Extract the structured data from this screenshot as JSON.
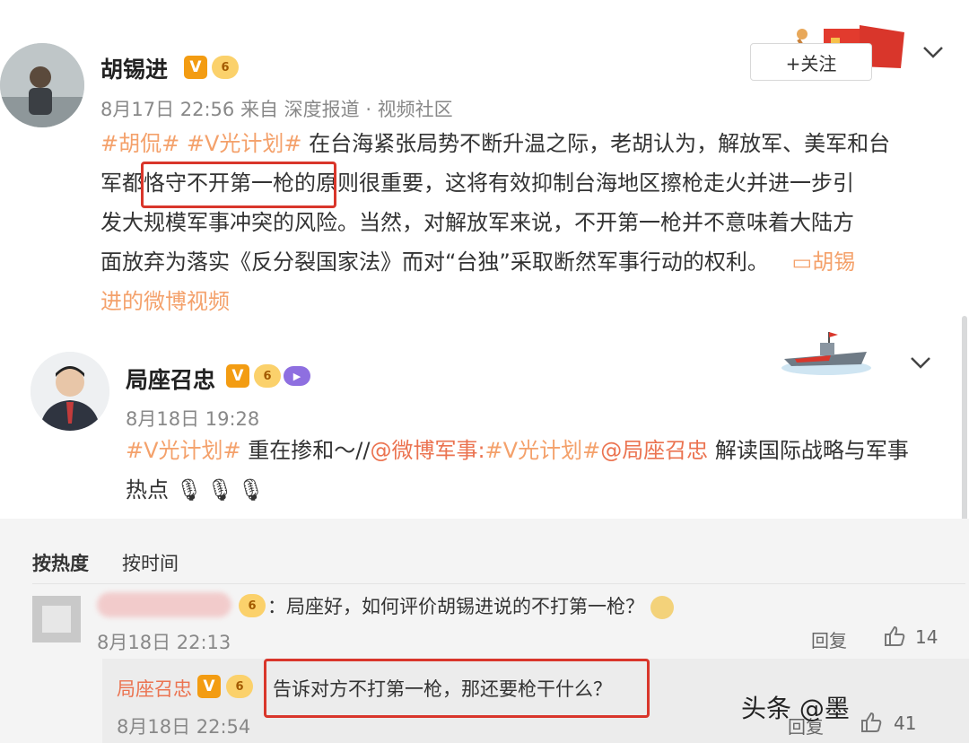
{
  "post1": {
    "author": "胡锡进",
    "date": "8月17日 22:56",
    "source": "来自 深度报道 · 视频社区",
    "follow_label": "+关注",
    "tag1": "#胡侃#",
    "tag2": "#V光计划#",
    "line1_text": " 在台海紧张局势不断升温之际，老胡认为，解放军、美军和台",
    "line2_pre": "军都",
    "line2_highlight": "恪守不开第一枪的",
    "line2_post": "原则很重要，这将有效抑制台海地区擦枪走火并进一步引",
    "line3": "发大规模军事冲突的风险。当然，对解放军来说，不开第一枪并不意味着大陆方",
    "line4": "面放弃为落实《反分裂国家法》而对“台独”采取断然军事行动的权利。",
    "video_link_a": "胡锡",
    "video_link_b": "进的微博视频"
  },
  "post2": {
    "author": "局座召忠",
    "date": "8月18日 19:28",
    "tag": "#V光计划#",
    "text_a": " 重在掺和～//",
    "mention1": "@微博军事",
    "text_b": ":",
    "tag2": "#V光计划#",
    "mention2": "@局座召忠",
    "text_c": " 解读国际战略与军事",
    "line2": "热点",
    "emoji": "🎙🎙🎙"
  },
  "sort_tabs": [
    "按热度",
    "按时间"
  ],
  "comment": {
    "text": "：局座好，如何评价胡锡进说的不打第一枪？",
    "date": "8月18日 22:13",
    "reply_label": "回复",
    "likes": "14"
  },
  "reply": {
    "author": "局座召忠",
    "text": "告诉对方不打第一枪，那还要枪干什么？",
    "date": "8月18日 22:54",
    "reply_label": "回复",
    "likes": "41"
  },
  "watermark": "头条 @墨",
  "badges": {
    "v": "V",
    "lv": "6"
  },
  "colors": {
    "tag": "#f4a16b",
    "mention": "#eb7350",
    "highlight_box": "#d9362b",
    "vip": "#f39c12"
  }
}
